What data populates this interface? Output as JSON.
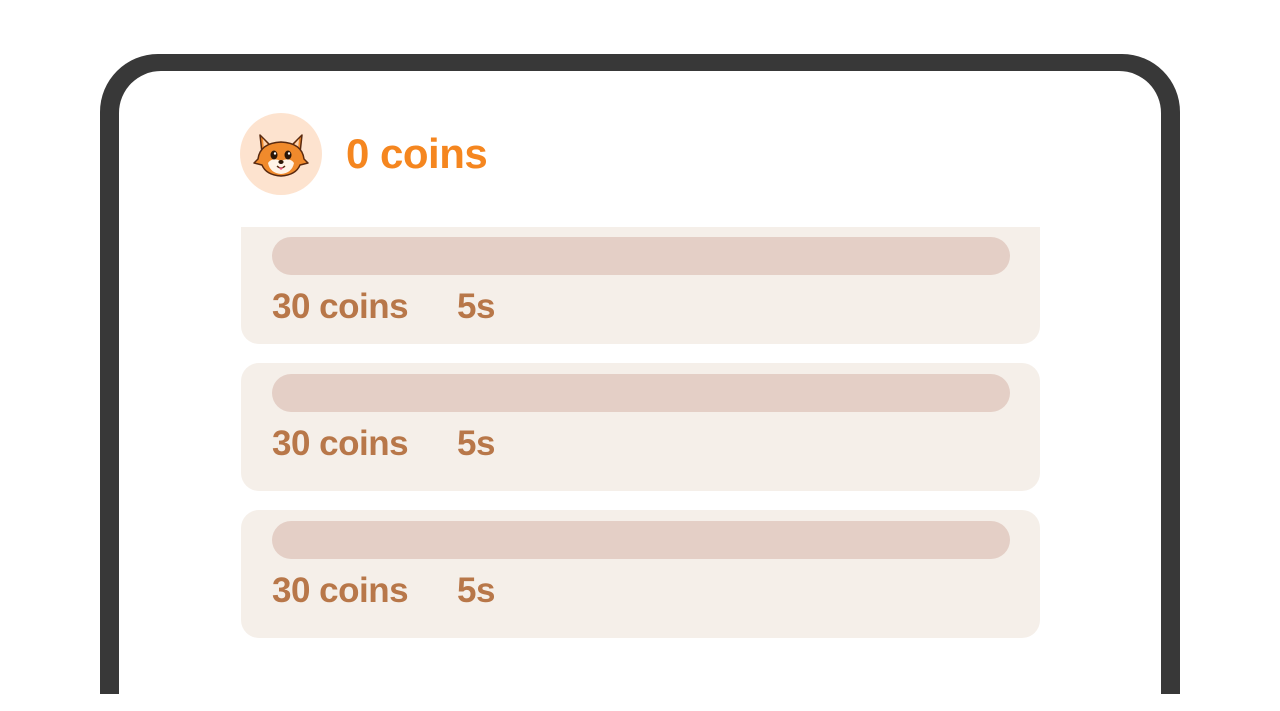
{
  "wallet": {
    "balance_text": "0 coins",
    "avatar_icon": "fox-mascot-icon",
    "accent_color": "#f5861f"
  },
  "offers": [
    {
      "reward": "30 coins",
      "duration": "5s",
      "progress": 0
    },
    {
      "reward": "30 coins",
      "duration": "5s",
      "progress": 0
    },
    {
      "reward": "30 coins",
      "duration": "5s",
      "progress": 0
    }
  ]
}
